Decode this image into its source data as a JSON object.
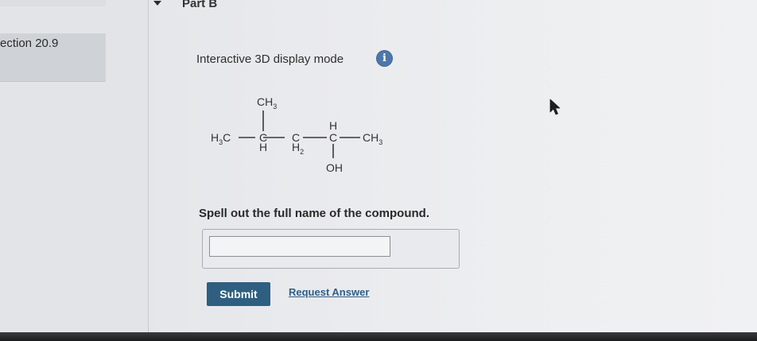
{
  "nav": {
    "active_item_label": "ection 20.9"
  },
  "part": {
    "title": "Part B",
    "mode_label": "Interactive 3D display mode",
    "info_icon": "info-icon",
    "info_glyph": "i"
  },
  "molecule": {
    "left_group": "H",
    "left_group_sub": "3",
    "left_group_tail": "C",
    "branch_top": "CH",
    "branch_top_sub": "3",
    "c1": "C",
    "c1_bottom": "H",
    "c2": "C",
    "c2_bottom": "H",
    "c2_bottom_sub": "2",
    "c3_top": "H",
    "c3": "C",
    "c3_bottom": "OH",
    "right_group": "CH",
    "right_group_sub": "3"
  },
  "question": {
    "prompt": "Spell out the full name of the compound.",
    "answer_value": "",
    "answer_placeholder": ""
  },
  "actions": {
    "submit_label": "Submit",
    "request_label": "Request Answer"
  },
  "colors": {
    "submit_bg": "#2e5f80",
    "link": "#2f5f86",
    "info_bg": "#4d77a8"
  }
}
